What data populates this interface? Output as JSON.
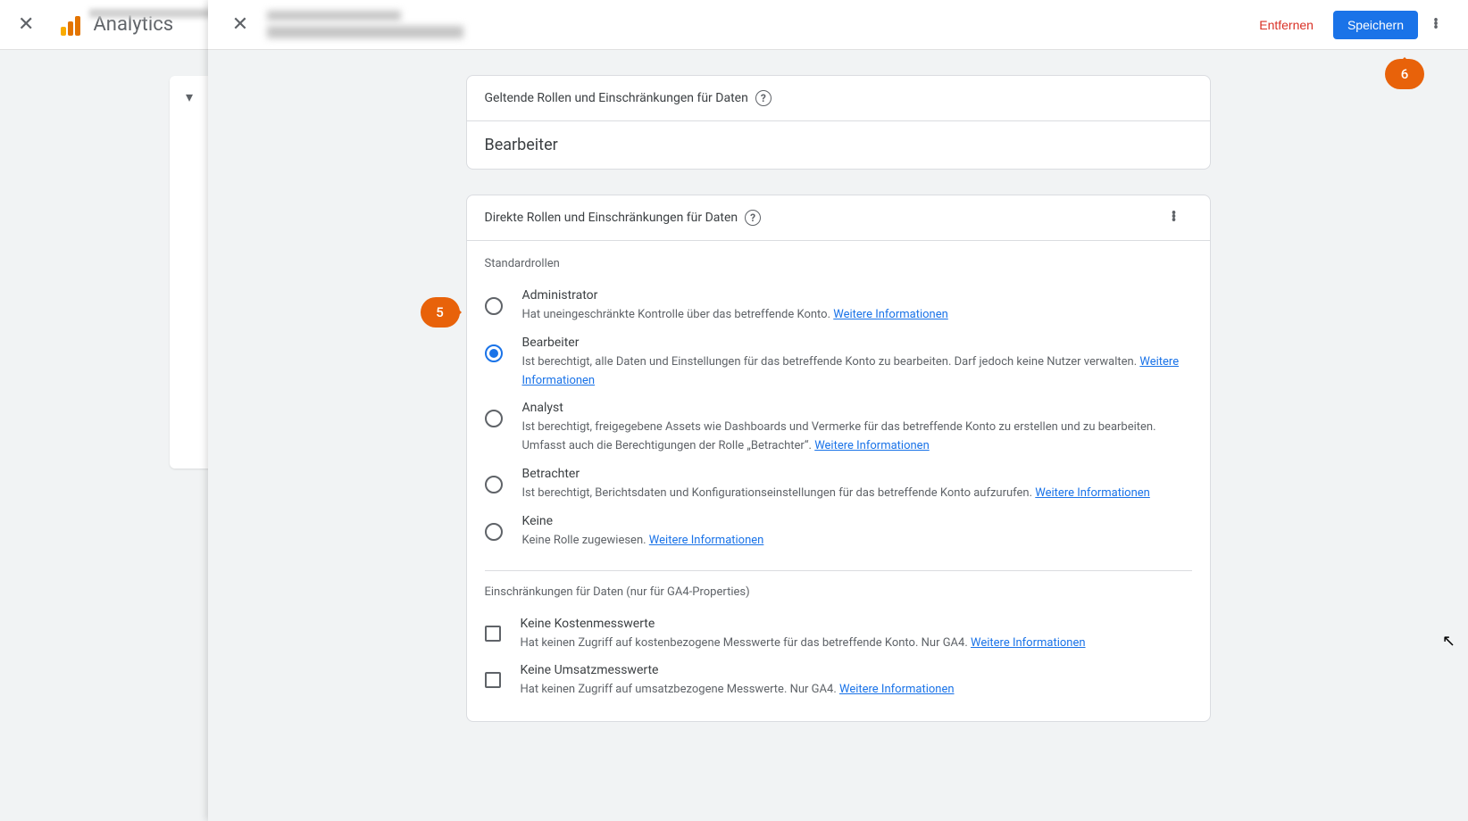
{
  "header": {
    "app_name": "Analytics",
    "remove_button": "Entfernen",
    "save_button": "Speichern"
  },
  "card_effective": {
    "title": "Geltende Rollen und Einschränkungen für Daten",
    "value": "Bearbeiter"
  },
  "card_direct": {
    "title": "Direkte Rollen und Einschränkungen für Daten",
    "standard_label": "Standardrollen",
    "restrictions_label": "Einschränkungen für Daten (nur für GA4-Properties)",
    "more_link": "Weitere Informationen",
    "roles": [
      {
        "name": "Administrator",
        "desc": "Hat uneingeschränkte Kontrolle über das betreffende Konto.",
        "selected": false
      },
      {
        "name": "Bearbeiter",
        "desc": "Ist berechtigt, alle Daten und Einstellungen für das betreffende Konto zu bearbeiten. Darf jedoch keine Nutzer verwalten.",
        "selected": true
      },
      {
        "name": "Analyst",
        "desc": "Ist berechtigt, freigegebene Assets wie Dashboards und Vermerke für das betreffende Konto zu erstellen und zu bearbeiten. Umfasst auch die Berechtigungen der Rolle „Betrachter“.",
        "selected": false
      },
      {
        "name": "Betrachter",
        "desc": "Ist berechtigt, Berichtsdaten und Konfigurationseinstellungen für das betreffende Konto aufzurufen.",
        "selected": false
      },
      {
        "name": "Keine",
        "desc": "Keine Rolle zugewiesen.",
        "selected": false
      }
    ],
    "restrictions": [
      {
        "name": "Keine Kostenmesswerte",
        "desc": "Hat keinen Zugriff auf kostenbezogene Messwerte für das betreffende Konto. Nur GA4."
      },
      {
        "name": "Keine Umsatzmesswerte",
        "desc": "Hat keinen Zugriff auf umsatzbezogene Messwerte. Nur GA4."
      }
    ]
  },
  "callouts": {
    "c5": "5",
    "c6": "6"
  }
}
